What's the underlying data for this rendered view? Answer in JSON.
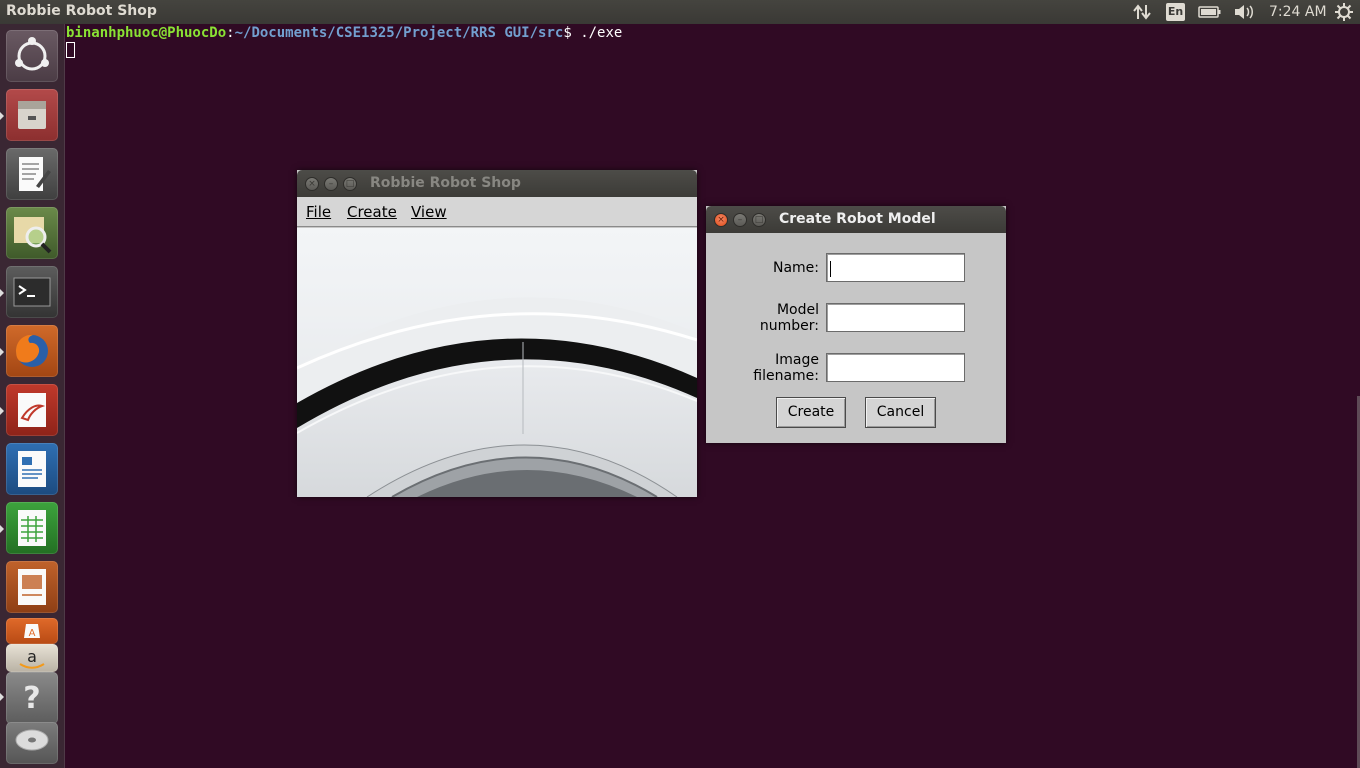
{
  "top_panel": {
    "app_title": "Robbie Robot Shop",
    "language": "En",
    "clock": "7:24 AM",
    "icons": [
      "network-arrows-icon",
      "battery-icon",
      "volume-icon",
      "settings-gear-icon"
    ]
  },
  "launcher": {
    "items": [
      {
        "name": "ubuntu-dash-icon"
      },
      {
        "name": "files-icon"
      },
      {
        "name": "text-editor-icon"
      },
      {
        "name": "image-viewer-icon"
      },
      {
        "name": "terminal-icon"
      },
      {
        "name": "firefox-icon"
      },
      {
        "name": "document-viewer-icon"
      },
      {
        "name": "libreoffice-writer-icon"
      },
      {
        "name": "libreoffice-calc-icon"
      },
      {
        "name": "libreoffice-impress-icon"
      },
      {
        "name": "software-center-icon"
      },
      {
        "name": "amazon-icon"
      },
      {
        "name": "help-icon"
      },
      {
        "name": "dvd-icon"
      }
    ]
  },
  "terminal": {
    "user_host": "binanhphuoc@PhuocDo",
    "separator": ":",
    "path": "~/Documents/CSE1325/Project/RRS GUI/src",
    "prompt": "$",
    "command": " ./exe"
  },
  "main_window": {
    "title": "Robbie Robot Shop",
    "menu": {
      "file": "File",
      "create": "Create",
      "view": "View"
    }
  },
  "dialog": {
    "title": "Create Robot Model",
    "name_label": "Name:",
    "model_label_line1": "Model",
    "model_label_line2": "number:",
    "image_label_line1": "Image",
    "image_label_line2": "filename:",
    "name_value": "",
    "model_value": "",
    "image_value": "",
    "create_button": "Create",
    "cancel_button": "Cancel"
  },
  "colors": {
    "desktop": "#300a24",
    "panel": "#3c3b37",
    "accent_close": "#df4a16"
  }
}
